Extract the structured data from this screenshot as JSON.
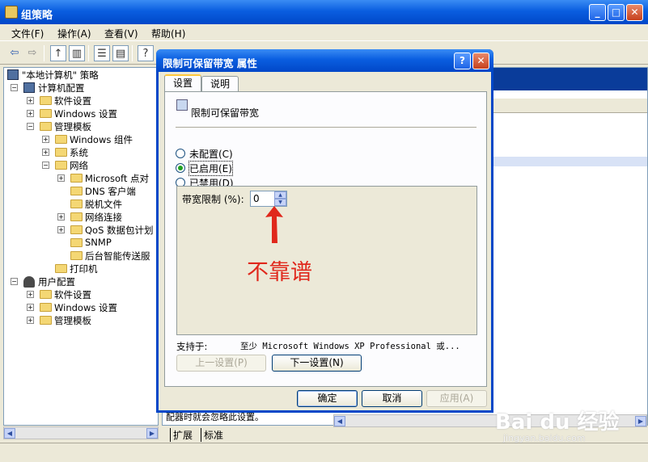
{
  "main_window": {
    "title": "组策略",
    "menu": [
      "文件(F)",
      "操作(A)",
      "查看(V)",
      "帮助(H)"
    ]
  },
  "tree": {
    "root": "\"本地计算机\" 策略",
    "computer_config": "计算机配置",
    "software_settings": "软件设置",
    "windows_settings": "Windows 设置",
    "admin_templates": "管理模板",
    "windows_components": "Windows 组件",
    "system": "系统",
    "network": "网络",
    "microsoft_p2p": "Microsoft 点对",
    "dns_client": "DNS 客户端",
    "offline_files": "脱机文件",
    "network_connections": "网络连接",
    "qos_packet_scheduler": "QoS 数据包计划",
    "snmp": "SNMP",
    "bits": "后台智能传送服",
    "printers": "打印机",
    "user_config": "用户配置",
    "user_software_settings": "软件设置",
    "user_windows_settings": "Windows 设置",
    "user_admin_templates": "管理模板"
  },
  "right_pane": {
    "bottom_text": "配器时就会忽略此设置。"
  },
  "view_tabs": [
    "扩展",
    "标准"
  ],
  "dialog": {
    "title": "限制可保留带宽 属性",
    "tabs": [
      "设置",
      "说明"
    ],
    "policy_name": "限制可保留带宽",
    "radio_not_configured": "未配置(C)",
    "radio_enabled": "已启用(E)",
    "radio_disabled": "已禁用(D)",
    "selected_option": "enabled",
    "bandwidth_label": "带宽限制 (%):",
    "bandwidth_value": "0",
    "supported_label": "支持于:",
    "supported_value": "至少 Microsoft Windows XP Professional 或...",
    "prev_setting": "上一设置(P)",
    "next_setting": "下一设置(N)",
    "ok": "确定",
    "cancel": "取消",
    "apply": "应用(A)"
  },
  "annotation": {
    "text": "不靠谱",
    "color": "#e0281c"
  },
  "watermark": {
    "text": "Bai du 经验",
    "url": "jingyan.baidu.com"
  },
  "colors": {
    "title_bar": "#0a5ee0",
    "window_bg": "#ece9d8"
  }
}
